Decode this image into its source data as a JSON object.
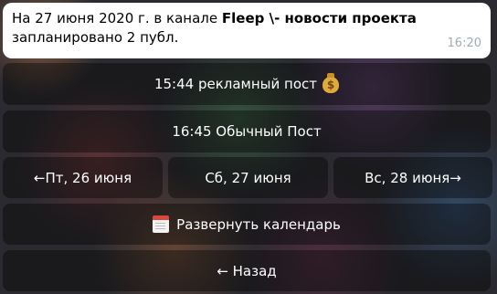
{
  "message": {
    "prefix": "На 27 июня 2020 г. в канале",
    "channel": "Fleep \\- новости проекта",
    "line2": "запланировано 2 публ.",
    "time": "16:20"
  },
  "keyboard": {
    "post1": "15:44 рекламный пост",
    "post2": "16:45 Обычный Пост",
    "prev_day": "←Пт, 26 июня",
    "current_day": "Сб, 27 июня",
    "next_day": "Вс, 28 июня→",
    "expand_calendar": "Развернуть календарь",
    "back": "← Назад"
  },
  "icons": {
    "post1_icon": "money-bag-icon",
    "calendar_icon": "calendar-icon"
  }
}
